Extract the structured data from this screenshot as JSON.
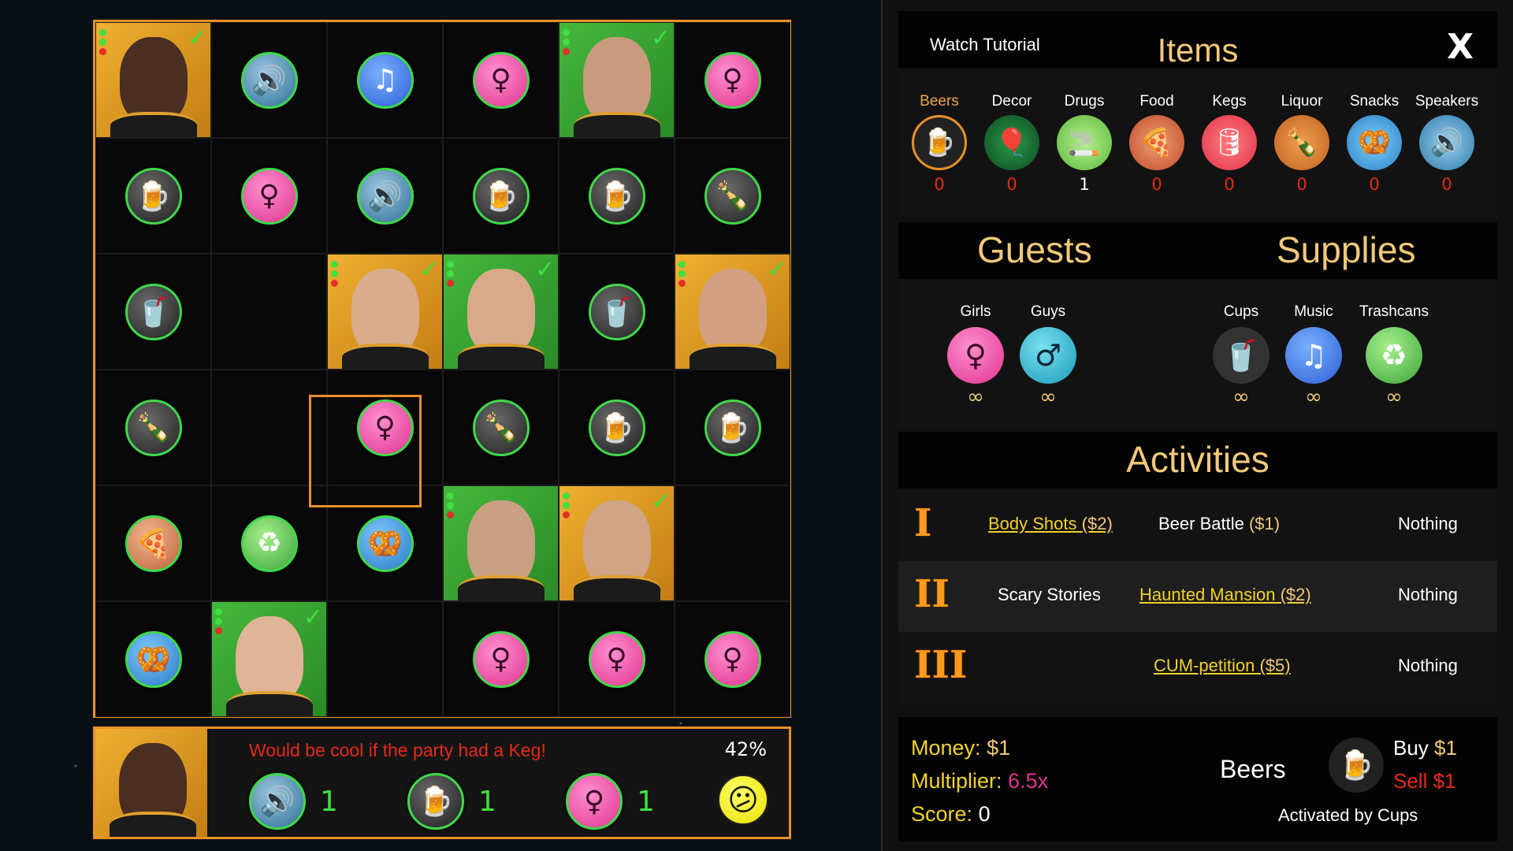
{
  "status": {
    "message": "Would be cool if the party had a Keg!",
    "percent": "42%",
    "requirements": [
      {
        "icon": "speaker-icon",
        "count": "1"
      },
      {
        "icon": "beer-icon",
        "count": "1"
      },
      {
        "icon": "girl-icon",
        "count": "1"
      }
    ],
    "mood_icon": "confused-face-icon"
  },
  "panel": {
    "tutorial_label": "Watch Tutorial",
    "items_title": "Items",
    "close_label": "X",
    "items": [
      {
        "label": "Beers",
        "count": "0",
        "selected": true
      },
      {
        "label": "Decor",
        "count": "0"
      },
      {
        "label": "Drugs",
        "count": "1"
      },
      {
        "label": "Food",
        "count": "0"
      },
      {
        "label": "Kegs",
        "count": "0"
      },
      {
        "label": "Liquor",
        "count": "0"
      },
      {
        "label": "Snacks",
        "count": "0"
      },
      {
        "label": "Speakers",
        "count": "0"
      }
    ],
    "guests_title": "Guests",
    "supplies_title": "Supplies",
    "guests": [
      {
        "label": "Girls",
        "count": "∞"
      },
      {
        "label": "Guys",
        "count": "∞"
      }
    ],
    "supplies": [
      {
        "label": "Cups",
        "count": "∞"
      },
      {
        "label": "Music",
        "count": "∞"
      },
      {
        "label": "Trashcans",
        "count": "∞"
      }
    ],
    "activities_title": "Activities",
    "activities": [
      {
        "tier": "I",
        "a": "Body Shots",
        "a_cost": "($2)",
        "b": "Beer Battle",
        "b_cost": "($1)",
        "c": "Nothing"
      },
      {
        "tier": "II",
        "a": "Scary Stories",
        "b": "Haunted Mansion",
        "b_cost": "($2)",
        "c": "Nothing"
      },
      {
        "tier": "III",
        "b": "CUM-petition",
        "b_cost": "($5)",
        "c": "Nothing"
      }
    ],
    "money_label": "Money:",
    "money_value": "$1",
    "multiplier_label": "Multiplier:",
    "multiplier_value": "6.5x",
    "score_label": "Score:",
    "score_value": "0",
    "selected_name": "Beers",
    "buy_label": "Buy",
    "buy_value": "$1",
    "sell_label": "Sell",
    "sell_value": "$1",
    "activated_by": "Activated by Cups"
  },
  "colors": {
    "accent": "#e8902a",
    "link": "#3fd94a",
    "title": "#f2c97a",
    "warning": "#e52a1c"
  }
}
